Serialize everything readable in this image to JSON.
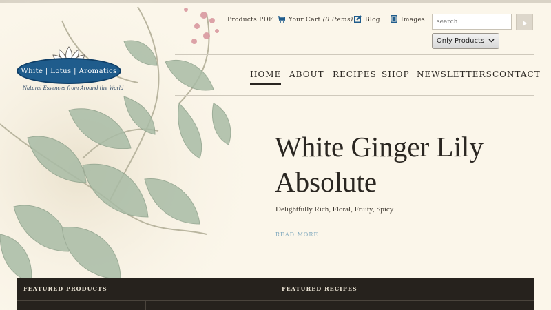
{
  "utility": {
    "products_pdf": "Products PDF",
    "cart_label": "Your Cart",
    "cart_count": "(0 Items)",
    "blog": "Blog",
    "images": "Images"
  },
  "search": {
    "placeholder": "search",
    "filter_value": "Only Products"
  },
  "logo": {
    "name": "White | Lotus | Aromatics",
    "tagline": "Natural Essences from Around the World"
  },
  "nav": {
    "items": [
      "HOME",
      "ABOUT",
      "RECIPES",
      "SHOP",
      "NEWSLETTERS",
      "CONTACT"
    ],
    "active": "HOME"
  },
  "hero": {
    "title": "White Ginger Lily Absolute",
    "subtitle": "Delightfully Rich, Floral, Fruity, Spicy",
    "link": "READ MORE"
  },
  "featured": {
    "products_heading": "FEATURED PRODUCTS",
    "recipes_heading": "FEATURED RECIPES"
  },
  "colors": {
    "accent_blue": "#1f5c8c",
    "link_blue": "#7fa8bd",
    "dark_panel": "#26221d",
    "background": "#fbf6ea"
  },
  "icons": [
    "cart-icon",
    "blog-icon",
    "images-icon",
    "search-submit-icon",
    "chevron-down-icon",
    "lotus-icon"
  ]
}
